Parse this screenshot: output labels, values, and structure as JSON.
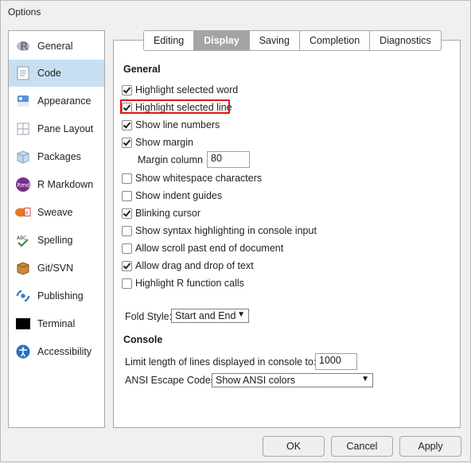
{
  "window": {
    "title": "Options"
  },
  "sidebar": {
    "items": [
      {
        "label": "General",
        "icon": "r-logo-icon",
        "selected": false
      },
      {
        "label": "Code",
        "icon": "code-document-icon",
        "selected": true
      },
      {
        "label": "Appearance",
        "icon": "paint-palette-icon",
        "selected": false
      },
      {
        "label": "Pane Layout",
        "icon": "pane-layout-icon",
        "selected": false
      },
      {
        "label": "Packages",
        "icon": "package-box-icon",
        "selected": false
      },
      {
        "label": "R Markdown",
        "icon": "rmd-icon",
        "selected": false
      },
      {
        "label": "Sweave",
        "icon": "sweave-icon",
        "selected": false
      },
      {
        "label": "Spelling",
        "icon": "spellcheck-icon",
        "selected": false
      },
      {
        "label": "Git/SVN",
        "icon": "git-box-icon",
        "selected": false
      },
      {
        "label": "Publishing",
        "icon": "publishing-icon",
        "selected": false
      },
      {
        "label": "Terminal",
        "icon": "terminal-icon",
        "selected": false
      },
      {
        "label": "Accessibility",
        "icon": "accessibility-icon",
        "selected": false
      }
    ]
  },
  "tabs": [
    {
      "label": "Editing",
      "active": false
    },
    {
      "label": "Display",
      "active": true
    },
    {
      "label": "Saving",
      "active": false
    },
    {
      "label": "Completion",
      "active": false
    },
    {
      "label": "Diagnostics",
      "active": false
    }
  ],
  "general": {
    "heading": "General",
    "options": [
      {
        "label": "Highlight selected word",
        "checked": true
      },
      {
        "label": "Highlight selected line",
        "checked": true,
        "highlighted": true
      },
      {
        "label": "Show line numbers",
        "checked": true
      },
      {
        "label": "Show margin",
        "checked": true
      },
      {
        "label": "Show whitespace characters",
        "checked": false
      },
      {
        "label": "Show indent guides",
        "checked": false
      },
      {
        "label": "Blinking cursor",
        "checked": true
      },
      {
        "label": "Show syntax highlighting in console input",
        "checked": false
      },
      {
        "label": "Allow scroll past end of document",
        "checked": false
      },
      {
        "label": "Allow drag and drop of text",
        "checked": true
      },
      {
        "label": "Highlight R function calls",
        "checked": false
      }
    ],
    "margin_column_label": "Margin column",
    "margin_column_value": "80",
    "fold_style_label": "Fold Style:",
    "fold_style_value": "Start and End"
  },
  "console": {
    "heading": "Console",
    "limit_label": "Limit length of lines displayed in console to:",
    "limit_value": "1000",
    "ansi_label": "ANSI Escape Codes:",
    "ansi_value": "Show ANSI colors"
  },
  "buttons": {
    "ok": "OK",
    "cancel": "Cancel",
    "apply": "Apply"
  },
  "colors": {
    "selection": "#c7dff2",
    "active_tab": "#a4a4a4",
    "highlight_border": "#e0161a"
  }
}
